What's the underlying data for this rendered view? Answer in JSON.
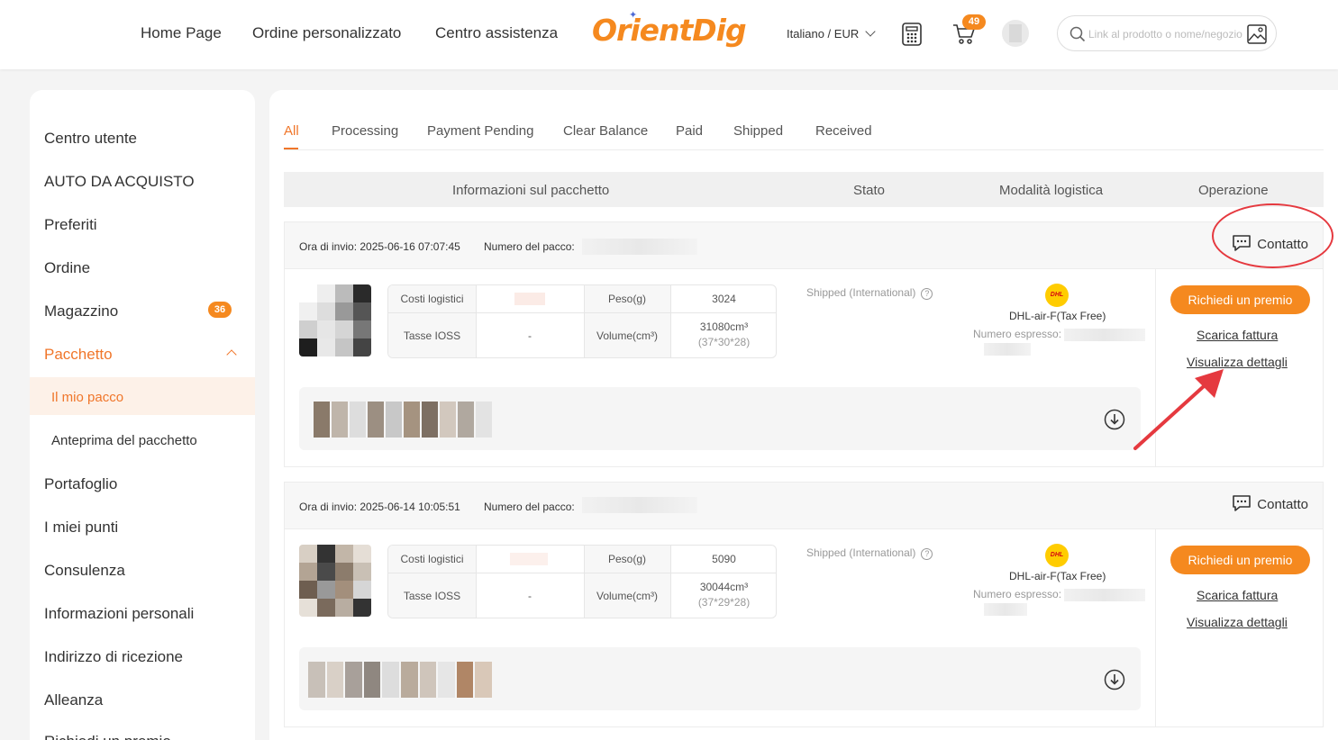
{
  "header": {
    "nav": [
      "Home Page",
      "Ordine personalizzato",
      "Centro assistenza"
    ],
    "logo_text": "OrientDig",
    "language": "Italiano",
    "currency": "EUR",
    "cart_count": "49",
    "search_placeholder": "Link al prodotto o nome/negozio"
  },
  "sidebar": {
    "items": [
      "Centro utente",
      "AUTO DA ACQUISTO",
      "Preferiti",
      "Ordine",
      "Magazzino",
      "Pacchetto",
      "Portafoglio",
      "I miei punti",
      "Consulenza",
      "Informazioni personali",
      "Indirizzo di ricezione",
      "Alleanza",
      "Richiedi un premio"
    ],
    "magazzino_badge": "36",
    "sub_items": [
      "Il mio pacco",
      "Anteprima del pacchetto"
    ]
  },
  "tabs": [
    "All",
    "Processing",
    "Payment Pending",
    "Clear Balance",
    "Paid",
    "Shipped",
    "Received"
  ],
  "table_headers": [
    "Informazioni sul pacchetto",
    "Stato",
    "Modalità logistica",
    "Operazione"
  ],
  "labels": {
    "send_time": "Ora di invio:",
    "package_number": "Numero del pacco:",
    "contact": "Contatto",
    "logistics_cost": "Costi logistici",
    "weight": "Peso(g)",
    "ioss": "Tasse IOSS",
    "volume": "Volume(cm³)",
    "express_number": "Numero espresso:",
    "request_prize": "Richiedi un premio",
    "download_invoice": "Scarica fattura",
    "view_details": "Visualizza dettagli"
  },
  "packages": [
    {
      "send_time": "2025-06-16 07:07:45",
      "ioss": "-",
      "weight": "3024",
      "volume": "31080cm³",
      "dimensions": "(37*30*28)",
      "status": "Shipped (International)",
      "logistics": "DHL-air-F(Tax Free)"
    },
    {
      "send_time": "2025-06-14 10:05:51",
      "ioss": "-",
      "weight": "5090",
      "volume": "30044cm³",
      "dimensions": "(37*29*28)",
      "status": "Shipped (International)",
      "logistics": "DHL-air-F(Tax Free)"
    }
  ],
  "dhl_logo_text": "DHL",
  "colors": {
    "accent": "#f5891f",
    "active_text": "#f0762a",
    "annotation": "#e5393f",
    "dhl_yellow": "#ffcc00"
  }
}
